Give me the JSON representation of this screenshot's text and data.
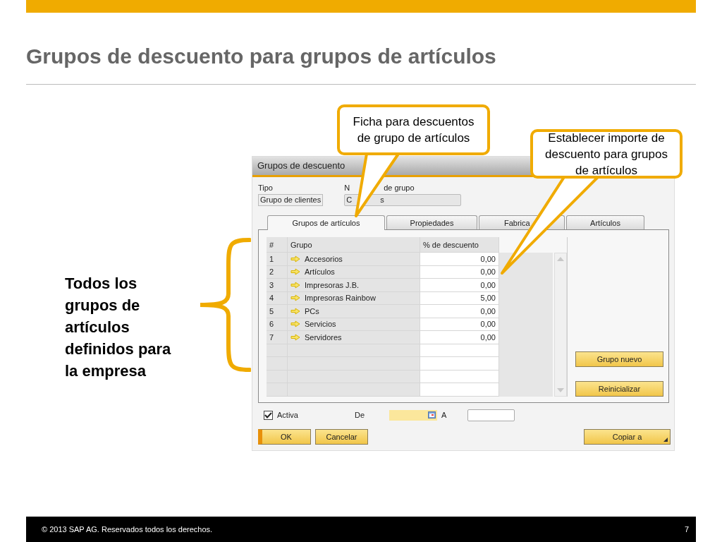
{
  "slide": {
    "title": "Grupos de descuento para grupos de artículos",
    "side_text": "Todos los grupos de artículos definidos para la empresa",
    "footer": "© 2013 SAP AG. Reservados todos los derechos.",
    "page_number": "7"
  },
  "callouts": [
    {
      "text": "Ficha para descuentos de grupo de artículos"
    },
    {
      "text": "Establecer importe de descuento para grupos de artículos"
    }
  ],
  "window": {
    "title": "Grupos de descuento",
    "type_label": "Tipo",
    "type_value": "Grupo de clientes",
    "name_label_parts": [
      "N",
      "de grupo"
    ],
    "name_value_parts": [
      "C",
      "s"
    ],
    "tabs": [
      {
        "label": "Grupos de artículos",
        "selected": true
      },
      {
        "label": "Propiedades",
        "selected": false
      },
      {
        "label": "Fabrica",
        "selected": false
      },
      {
        "label": "Artículos",
        "selected": false
      }
    ],
    "table": {
      "columns": [
        "#",
        "Grupo",
        "% de descuento"
      ],
      "rows": [
        {
          "num": "1",
          "group": "Accesorios",
          "discount": "0,00"
        },
        {
          "num": "2",
          "group": "Artículos",
          "discount": "0,00"
        },
        {
          "num": "3",
          "group": "Impresoras J.B.",
          "discount": "0,00"
        },
        {
          "num": "4",
          "group": "Impresoras Rainbow",
          "discount": "5,00"
        },
        {
          "num": "5",
          "group": "PCs",
          "discount": "0,00"
        },
        {
          "num": "6",
          "group": "Servicios",
          "discount": "0,00"
        },
        {
          "num": "7",
          "group": "Servidores",
          "discount": "0,00"
        }
      ]
    },
    "side_buttons": [
      "Grupo nuevo",
      "Reinicializar"
    ],
    "active": {
      "label": "Activa",
      "checked": true
    },
    "from_label": "De",
    "to_label": "A",
    "buttons": [
      {
        "label": "OK",
        "default": true
      },
      {
        "label": "Cancelar",
        "default": false
      }
    ],
    "copy_button": "Copiar a"
  }
}
